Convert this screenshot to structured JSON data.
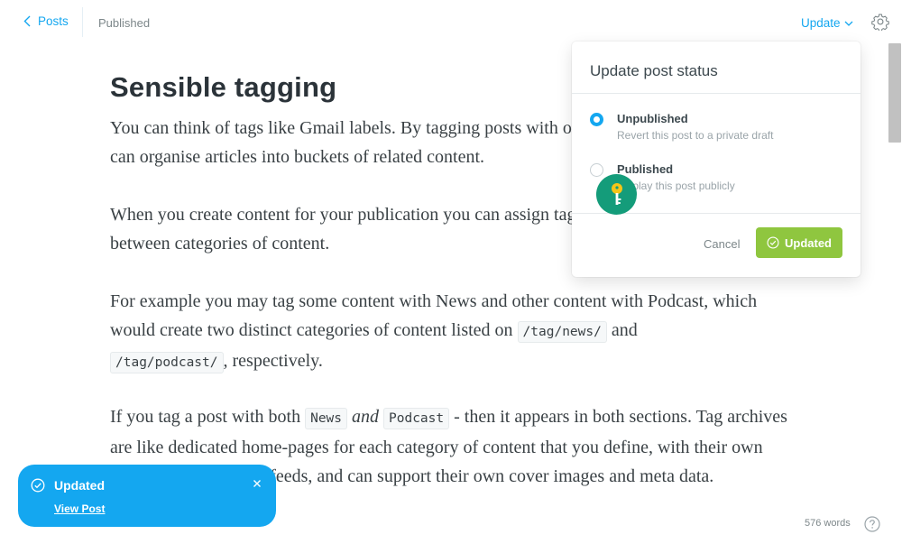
{
  "topbar": {
    "back_label": "Posts",
    "status": "Published",
    "update_label": "Update"
  },
  "post": {
    "title": "Sensible tagging",
    "p1": "You can think of tags like Gmail labels. By tagging posts with one or more keyword, you can organise articles into buckets of related content.",
    "p2": "When you create content for your publication you can assign tags to help differentiate between categories of content.",
    "p3_a": "For example you may tag some content with News and other content with Podcast, which would create two distinct categories of content listed on ",
    "p3_code1": "/tag/news/",
    "p3_b": " and ",
    "p3_code2": "/tag/podcast/",
    "p3_c": ", respectively.",
    "p4_a": "If you tag a post with both ",
    "p4_code1": "News",
    "p4_em": "and",
    "p4_code2": "Podcast",
    "p4_b": " - then it appears in both sections. Tag archives are like dedicated home-pages for each category of content that you define, with their own pages, their own RSS feeds, and can support their own cover images and meta data."
  },
  "popover": {
    "title": "Update post status",
    "options": [
      {
        "label": "Unpublished",
        "desc": "Revert this post to a private draft",
        "selected": true
      },
      {
        "label": "Published",
        "desc": "Display this post publicly",
        "selected": false
      }
    ],
    "cancel_label": "Cancel",
    "confirm_label": "Updated"
  },
  "toast": {
    "title": "Updated",
    "link": "View Post"
  },
  "footer": {
    "word_count": "576 words"
  },
  "colors": {
    "accent": "#14a7f0",
    "success": "#8fc63f",
    "cursor": "#149c7a",
    "key": "#f5c518"
  },
  "icons": [
    "chevron-left-icon",
    "chevron-down-icon",
    "gear-icon",
    "check-circle-icon",
    "close-icon",
    "help-icon",
    "key-icon"
  ]
}
